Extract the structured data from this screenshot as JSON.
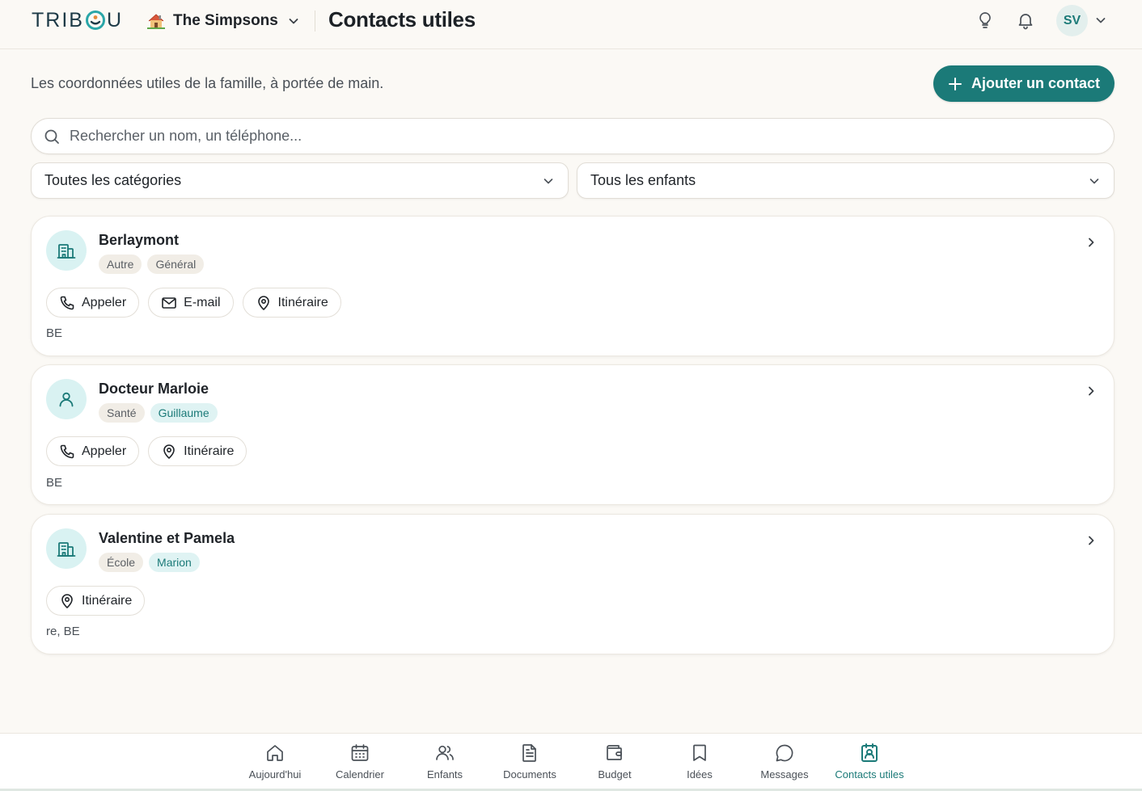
{
  "app": {
    "logo_text_before": "TRIB",
    "logo_text_after": "U",
    "family_name": "The Simpsons",
    "page_title": "Contacts utiles",
    "user_initials": "SV"
  },
  "main": {
    "subtitle": "Les coordonnées utiles de la famille, à portée de main.",
    "add_button_label": "Ajouter un contact",
    "search_placeholder": "Rechercher un nom, un téléphone...",
    "category_filter": "Toutes les catégories",
    "child_filter": "Tous les enfants"
  },
  "contacts": [
    {
      "name": "Berlaymont",
      "icon": "building-icon",
      "tags": [
        {
          "label": "Autre",
          "style": "neutral"
        },
        {
          "label": "Général",
          "style": "neutral"
        }
      ],
      "actions": [
        "Appeler",
        "E-mail",
        "Itinéraire"
      ],
      "address": "BE"
    },
    {
      "name": "Docteur Marloie",
      "icon": "person-icon",
      "tags": [
        {
          "label": "Santé",
          "style": "neutral"
        },
        {
          "label": "Guillaume",
          "style": "teal"
        }
      ],
      "actions": [
        "Appeler",
        "Itinéraire"
      ],
      "address": "BE"
    },
    {
      "name": "Valentine et Pamela",
      "icon": "building-icon",
      "tags": [
        {
          "label": "École",
          "style": "neutral"
        },
        {
          "label": "Marion",
          "style": "teal"
        }
      ],
      "actions": [
        "Itinéraire"
      ],
      "address": "re, BE"
    }
  ],
  "bottom_nav": [
    {
      "label": "Aujourd'hui",
      "icon": "home-icon"
    },
    {
      "label": "Calendrier",
      "icon": "calendar-icon"
    },
    {
      "label": "Enfants",
      "icon": "users-icon"
    },
    {
      "label": "Documents",
      "icon": "document-icon"
    },
    {
      "label": "Budget",
      "icon": "wallet-icon"
    },
    {
      "label": "Idées",
      "icon": "bookmark-icon"
    },
    {
      "label": "Messages",
      "icon": "message-icon"
    },
    {
      "label": "Contacts utiles",
      "icon": "contact-book-icon",
      "active": true
    }
  ],
  "colors": {
    "accent": "#1b7a78",
    "background": "#fbf9f5",
    "tag_teal_bg": "#dff3f3",
    "tag_neutral_bg": "#f1ede6"
  }
}
